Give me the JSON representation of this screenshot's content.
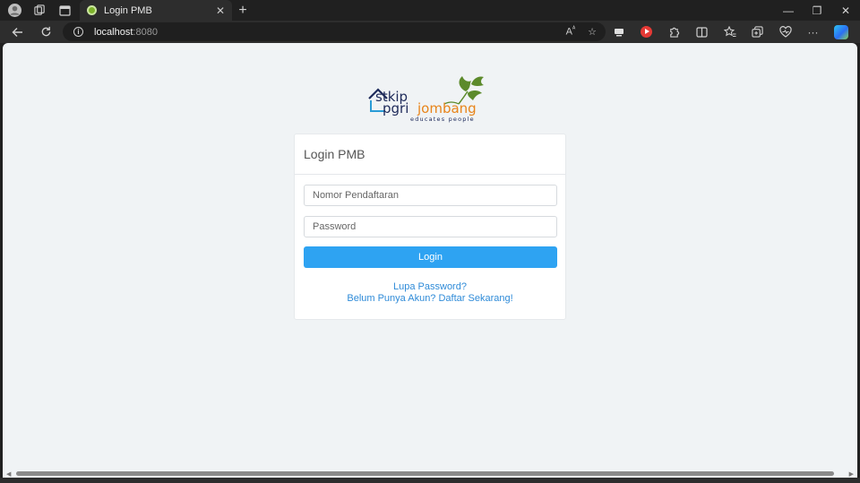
{
  "browser": {
    "tab_title": "Login PMB",
    "tab_close": "✕",
    "new_tab": "+",
    "url_host": "localhost",
    "url_port": ":8080",
    "icons": [
      "profile-icon",
      "workspaces-icon",
      "tab-actions-icon",
      "back-icon",
      "refresh-icon",
      "info-icon",
      "read-aloud-icon",
      "favorite-icon",
      "extensions-icon",
      "split-screen-icon",
      "favorites-icon",
      "collections-icon",
      "browser-essentials-icon",
      "more-icon",
      "copilot-icon"
    ]
  },
  "logo": {
    "text_stkip": "stkip",
    "text_pgri": "pgri",
    "text_jombang": "jombang",
    "tagline": "educates people",
    "colors": {
      "dark": "#1e2a5a",
      "orange": "#e8841a",
      "green": "#5c8a2b"
    }
  },
  "login": {
    "title": "Login PMB",
    "registration_placeholder": "Nomor Pendaftaran",
    "password_placeholder": "Password",
    "login_button": "Login",
    "forgot_password": "Lupa Password?",
    "register_link": "Belum Punya Akun? Daftar Sekarang!"
  },
  "colors": {
    "accent": "#2ea3f2",
    "link": "#2f8bd8",
    "page_background": "#f0f3f5"
  }
}
